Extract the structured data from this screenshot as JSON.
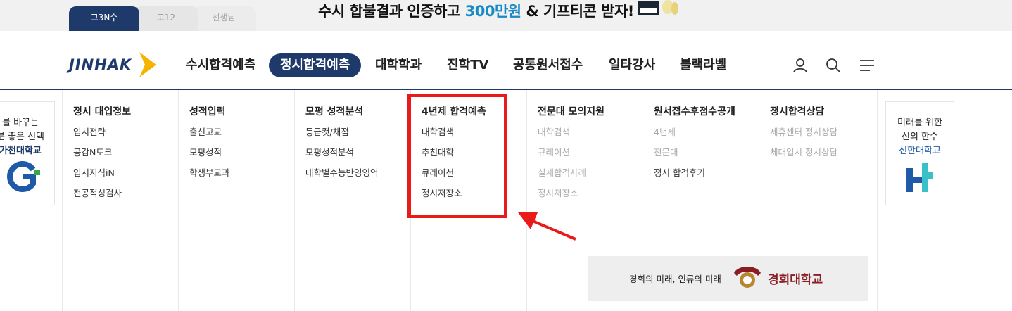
{
  "user_tabs": [
    {
      "label": "고3N수",
      "active": true
    },
    {
      "label": "고12",
      "active": false
    },
    {
      "label": "선생님",
      "active": false
    }
  ],
  "banner": {
    "text_before": "수시 합불결과 인증하고 ",
    "highlight": "300만원",
    "text_after": " & 기프티콘 받자!"
  },
  "logo": {
    "text": "JINHAK"
  },
  "gnb": [
    {
      "label": "수시합격예측",
      "active": false
    },
    {
      "label": "정시합격예측",
      "active": true
    },
    {
      "label": "대학학과",
      "active": false
    },
    {
      "label": "진학TV",
      "active": false
    },
    {
      "label": "공통원서접수",
      "active": false
    },
    {
      "label": "일타강사",
      "active": false
    },
    {
      "label": "블랙라벨",
      "active": false
    }
  ],
  "header_icons": [
    "user-icon",
    "search-icon",
    "menu-icon"
  ],
  "left_ad": {
    "line1": "를 바꾸는",
    "line2": "분 좋은 선택",
    "line3": "가천대학교"
  },
  "right_ad": {
    "line1": "미래를 위한",
    "line2": "신의 한수",
    "line3": "신한대학교"
  },
  "columns": [
    {
      "title": "정시 대입정보",
      "items": [
        {
          "label": "입시전략",
          "dim": false
        },
        {
          "label": "공감N토크",
          "dim": false
        },
        {
          "label": "입시지식iN",
          "dim": false
        },
        {
          "label": "전공적성검사",
          "dim": false
        }
      ]
    },
    {
      "title": "성적입력",
      "items": [
        {
          "label": "출신고교",
          "dim": false
        },
        {
          "label": "모평성적",
          "dim": false
        },
        {
          "label": "학생부교과",
          "dim": false
        }
      ]
    },
    {
      "title": "모평 성적분석",
      "items": [
        {
          "label": "등급컷/채점",
          "dim": false
        },
        {
          "label": "모평성적분석",
          "dim": false
        },
        {
          "label": "대학별수능반영영역",
          "dim": false
        }
      ]
    },
    {
      "title": "4년제 합격예측",
      "items": [
        {
          "label": "대학검색",
          "dim": false
        },
        {
          "label": "추천대학",
          "dim": false
        },
        {
          "label": "큐레이션",
          "dim": false
        },
        {
          "label": "정시저장소",
          "dim": false
        }
      ]
    },
    {
      "title": "전문대 모의지원",
      "items": [
        {
          "label": "대학검색",
          "dim": true
        },
        {
          "label": "큐레이션",
          "dim": true
        },
        {
          "label": "실제합격사례",
          "dim": true
        },
        {
          "label": "정시저장소",
          "dim": true
        }
      ]
    },
    {
      "title": "원서접수후점수공개",
      "items": [
        {
          "label": "4년제",
          "dim": true
        },
        {
          "label": "전문대",
          "dim": true
        },
        {
          "label": "정시 합격후기",
          "dim": false
        }
      ]
    },
    {
      "title": "정시합격상담",
      "items": [
        {
          "label": "제휴센터 정시상담",
          "dim": true
        },
        {
          "label": "체대입시 정시상담",
          "dim": true
        }
      ]
    }
  ],
  "bottom_ad": {
    "text": "경희의 미래, 인류의 미래",
    "name": "경희대학교"
  },
  "colors": {
    "navy": "#1e3a6b",
    "highlight_red": "#e81a1a",
    "banner_accent": "#1a8ac6",
    "khu_red": "#8a1c24"
  }
}
